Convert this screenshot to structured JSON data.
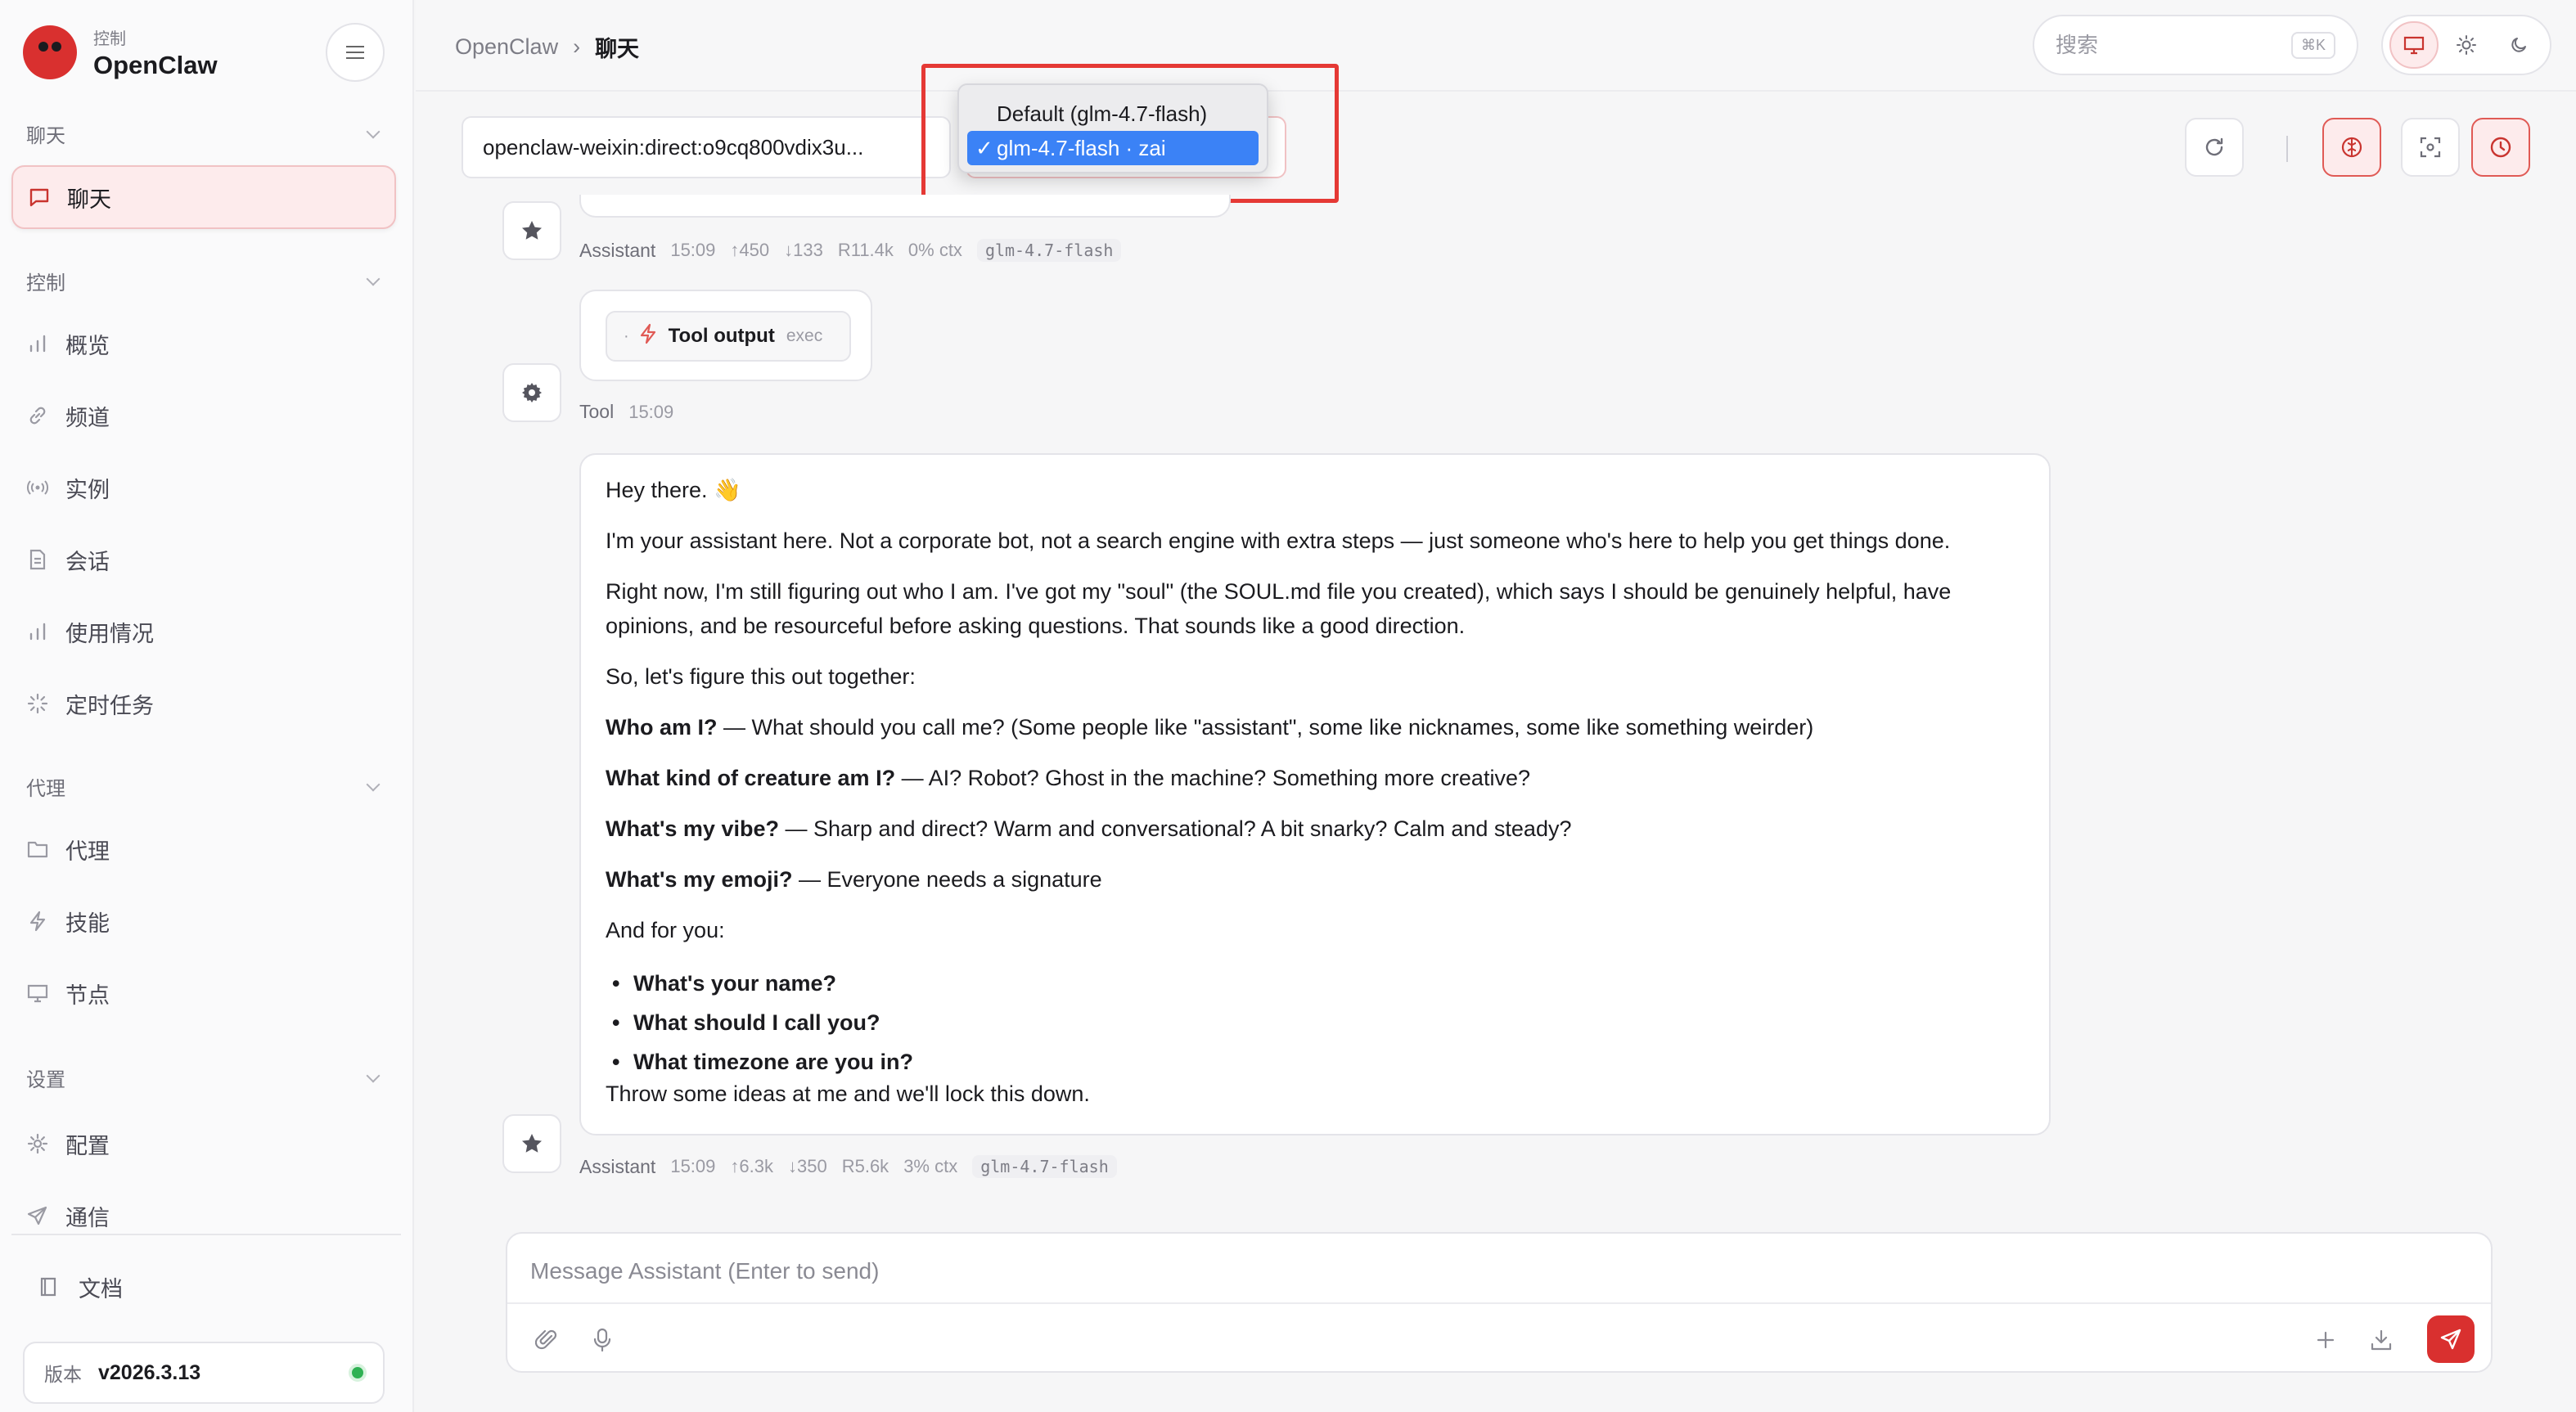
{
  "sidebar": {
    "brand_sub": "控制",
    "brand_name": "OpenClaw",
    "sections": [
      {
        "label": "聊天"
      },
      {
        "label": "控制"
      },
      {
        "label": "代理"
      },
      {
        "label": "设置"
      }
    ],
    "items": [
      {
        "label": "聊天",
        "icon": "chat-icon"
      },
      {
        "label": "概览",
        "icon": "bar-chart-icon"
      },
      {
        "label": "频道",
        "icon": "link-icon"
      },
      {
        "label": "实例",
        "icon": "broadcast-icon"
      },
      {
        "label": "会话",
        "icon": "document-icon"
      },
      {
        "label": "使用情况",
        "icon": "bar-chart-icon"
      },
      {
        "label": "定时任务",
        "icon": "loader-icon"
      },
      {
        "label": "代理",
        "icon": "folder-icon"
      },
      {
        "label": "技能",
        "icon": "bolt-icon"
      },
      {
        "label": "节点",
        "icon": "monitor-icon"
      },
      {
        "label": "配置",
        "icon": "gear-icon"
      },
      {
        "label": "通信",
        "icon": "send-icon"
      }
    ],
    "docs_label": "文档",
    "version_label": "版本",
    "version_value": "v2026.3.13"
  },
  "topbar": {
    "breadcrumb_root": "OpenClaw",
    "breadcrumb_sep": "›",
    "breadcrumb_current": "聊天",
    "search_placeholder": "搜索",
    "search_shortcut": "⌘K"
  },
  "chat": {
    "session_key": "openclaw-weixin:direct:o9cq800vdix3u...",
    "model_dropdown": {
      "options": [
        "Default (glm-4.7-flash)",
        "glm-4.7-flash · zai"
      ],
      "selected_index": 1,
      "check": "✓"
    },
    "messages": [
      {
        "role": "Assistant",
        "time": "15:09",
        "in_tokens": "↑450",
        "out_tokens": "↓133",
        "cache": "R11.4k",
        "ctx": "0% ctx",
        "model": "glm-4.7-flash"
      },
      {
        "role": "Tool",
        "time": "15:09",
        "tool_label": "Tool output",
        "tool_tag": "exec"
      },
      {
        "role": "Assistant",
        "time": "15:09",
        "in_tokens": "↑6.3k",
        "out_tokens": "↓350",
        "cache": "R5.6k",
        "ctx": "3% ctx",
        "model": "glm-4.7-flash",
        "body": {
          "p1": "Hey there. 👋",
          "p2": "I'm your assistant here. Not a corporate bot, not a search engine with extra steps — just someone who's here to help you get things done.",
          "p3": "Right now, I'm still figuring out who I am. I've got my \"soul\" (the SOUL.md file you created), which says I should be genuinely helpful, have opinions, and be resourceful before asking questions. That sounds like a good direction.",
          "p4": "So, let's figure this out together:",
          "q1_bold": "Who am I?",
          "q1_rest": " — What should you call me? (Some people like \"assistant\", some like nicknames, some like something weirder)",
          "q2_bold": "What kind of creature am I?",
          "q2_rest": " — AI? Robot? Ghost in the machine? Something more creative?",
          "q3_bold": "What's my vibe?",
          "q3_rest": " — Sharp and direct? Warm and conversational? A bit snarky? Calm and steady?",
          "q4_bold": "What's my emoji?",
          "q4_rest": " — Everyone needs a signature",
          "p5": "And for you:",
          "bullets": [
            "What's your name?",
            "What should I call you?",
            "What timezone are you in?"
          ],
          "closing": "Throw some ideas at me and we'll lock this down."
        }
      }
    ],
    "composer_placeholder": "Message Assistant (Enter to send)"
  },
  "colors": {
    "accent": "#d9302f",
    "highlight_box": "#e53935",
    "selection": "#3b82f6",
    "status_ok": "#2fb153"
  }
}
